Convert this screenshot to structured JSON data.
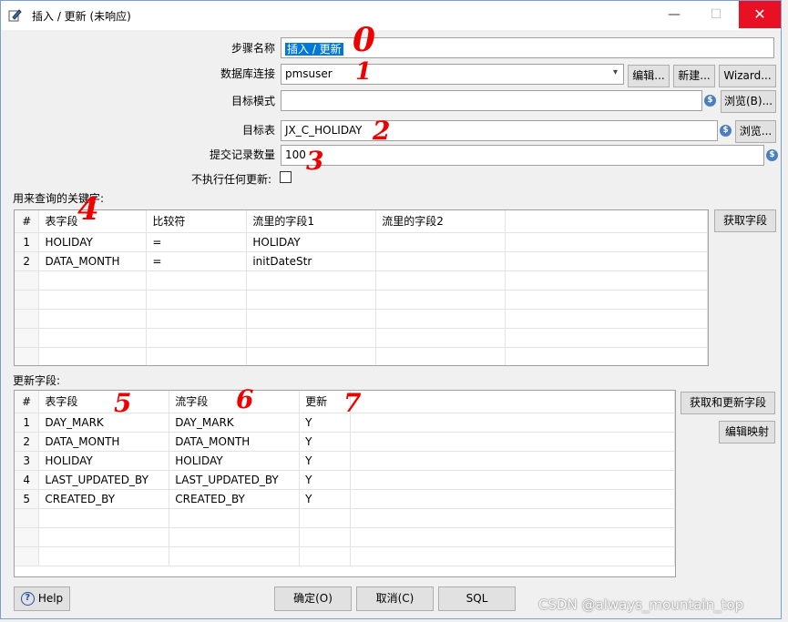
{
  "window": {
    "title": "插入 / 更新 (未响应)",
    "minimize": "—",
    "maximize": "☐",
    "close": "✕"
  },
  "form": {
    "step_name_label": "步骤名称",
    "step_name_value": "插入 / 更新",
    "db_conn_label": "数据库连接",
    "db_conn_value": "pmsuser",
    "edit_button": "编辑...",
    "new_button": "新建...",
    "wizard_button": "Wizard...",
    "target_schema_label": "目标模式",
    "target_schema_value": "",
    "browse_b_button": "浏览(B)...",
    "target_table_label": "目标表",
    "target_table_value": "JX_C_HOLIDAY",
    "browse_button": "浏览...",
    "commit_size_label": "提交记录数量",
    "commit_size_value": "100",
    "no_update_label": "不执行任何更新:"
  },
  "lookup_keys": {
    "section_label": "用来查询的关键字:",
    "get_fields_button": "获取字段",
    "columns": [
      "#",
      "表字段",
      "比较符",
      "流里的字段1",
      "流里的字段2",
      ""
    ],
    "rows": [
      [
        "1",
        "HOLIDAY",
        "=",
        "HOLIDAY",
        "",
        ""
      ],
      [
        "2",
        "DATA_MONTH",
        "=",
        "initDateStr",
        "",
        ""
      ]
    ]
  },
  "update_fields": {
    "section_label": "更新字段:",
    "get_update_fields_button": "获取和更新字段",
    "edit_mapping_button": "编辑映射",
    "columns": [
      "#",
      "表字段",
      "流字段",
      "更新",
      ""
    ],
    "rows": [
      [
        "1",
        "DAY_MARK",
        "DAY_MARK",
        "Y",
        ""
      ],
      [
        "2",
        "DATA_MONTH",
        "DATA_MONTH",
        "Y",
        ""
      ],
      [
        "3",
        "HOLIDAY",
        "HOLIDAY",
        "Y",
        ""
      ],
      [
        "4",
        "LAST_UPDATED_BY",
        "LAST_UPDATED_BY",
        "Y",
        ""
      ],
      [
        "5",
        "CREATED_BY",
        "CREATED_BY",
        "Y",
        ""
      ]
    ]
  },
  "footer": {
    "help_button": "Help",
    "ok_button": "确定(O)",
    "cancel_button": "取消(C)",
    "sql_button": "SQL"
  },
  "annotations": [
    "0",
    "1",
    "2",
    "3",
    "4",
    "5",
    "6",
    "7"
  ],
  "watermark": "CSDN @always_mountain_top",
  "colors": {
    "selection": "#0078d7",
    "close": "#e81123",
    "annotation": "#e00000"
  }
}
